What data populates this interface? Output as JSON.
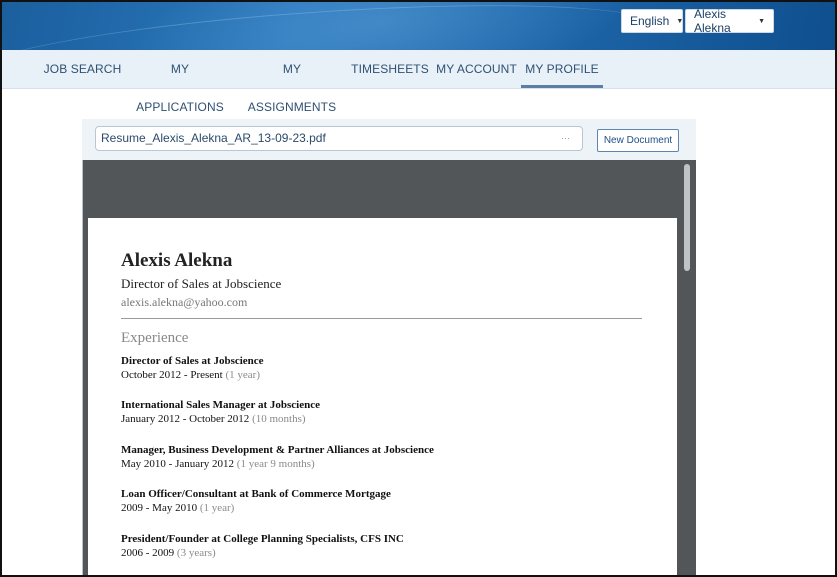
{
  "header": {
    "language": "English",
    "user": "Alexis Alekna"
  },
  "nav": {
    "items": [
      "JOB SEARCH",
      "MY APPLICATIONS",
      "MY ASSIGNMENTS",
      "TIMESHEETS",
      "MY ACCOUNT",
      "MY PROFILE"
    ],
    "active": "MY PROFILE"
  },
  "document": {
    "file_name": "Resume_Alexis_Alekna_AR_13-09-23.pdf",
    "new_button": "New Document"
  },
  "resume": {
    "name": "Alexis Alekna",
    "headline": "Director of Sales at Jobscience",
    "email": "alexis.alekna@yahoo.com",
    "section_title": "Experience",
    "jobs": [
      {
        "title": "Director of Sales  at  Jobscience",
        "dates": "October 2012  -  Present",
        "duration": "(1 year)"
      },
      {
        "title": "International Sales Manager  at  Jobscience",
        "dates": "January 2012  -  October 2012",
        "duration": "(10 months)"
      },
      {
        "title": "Manager, Business Development & Partner Alliances  at  Jobscience",
        "dates": "May 2010  -  January 2012",
        "duration": "(1 year 9 months)"
      },
      {
        "title": "Loan Officer/Consultant  at  Bank of Commerce Mortgage",
        "dates": "2009  -  May 2010",
        "duration": "(1 year)"
      },
      {
        "title": "President/Founder  at  College Planning Specialists, CFS INC",
        "dates": "2006  -  2009",
        "duration": "(3 years)"
      }
    ]
  },
  "colors": {
    "banner": "#2a78bd",
    "nav_background": "#e9f1f8",
    "nav_text": "#2f5073",
    "viewer_background": "#525659"
  }
}
